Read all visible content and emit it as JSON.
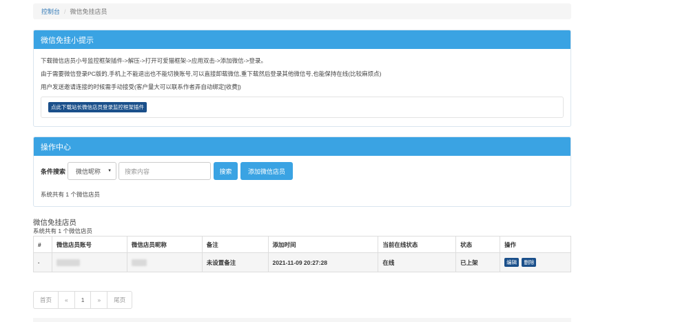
{
  "breadcrumb": {
    "home": "控制台",
    "separator": "/",
    "current": "微信免挂店员"
  },
  "tips": {
    "title": "微信免挂小提示",
    "lines": [
      "下载微信店员小号监控框架插件->解压->打开可爱猫框架->应用双击->添加微信->登录。",
      "由于需要微信登录PC版的,手机上不能退出也不能切换账号,可以直接卸载微信,重下载然后登录其他微信号,也能保持在线(比较麻烦点)",
      "用户发送邀请连接的时候需手动接受(客户量大可以联系作者弄自动绑定[收费])"
    ],
    "download_button": "点此下载站长微信店员登录监控框架插件"
  },
  "ops": {
    "title": "操作中心",
    "search_label": "条件搜索",
    "select_value": "微信昵称",
    "search_placeholder": "搜索内容",
    "search_button": "搜索",
    "add_button": "添加微信店员",
    "system_count": "系统共有 1 个微信店员"
  },
  "list": {
    "title": "微信免挂店员",
    "subtitle": "系统共有 1 个微信店员",
    "columns": [
      "#",
      "微信店员账号",
      "微信店员昵称",
      "备注",
      "添加时间",
      "当前在线状态",
      "状态",
      "操作"
    ],
    "rows": [
      {
        "id": "·",
        "remark": "未设置备注",
        "add_time": "2021-11-09 20:27:28",
        "online": "在线",
        "status": "已上架",
        "edit": "编辑",
        "delete": "删除"
      }
    ]
  },
  "pagination": {
    "first": "首页",
    "prev": "«",
    "page": "1",
    "next": "»",
    "last": "尾页"
  }
}
